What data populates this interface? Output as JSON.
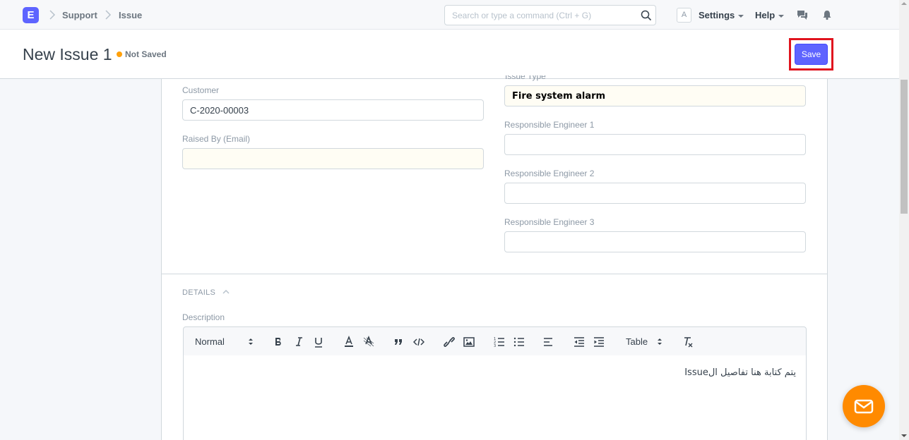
{
  "navbar": {
    "logo_letter": "E",
    "breadcrumbs": [
      "Support",
      "Issue"
    ],
    "search_placeholder": "Search or type a command (Ctrl + G)",
    "avatar_letter": "A",
    "settings_label": "Settings",
    "help_label": "Help"
  },
  "page": {
    "title": "New Issue 1",
    "status": "Not Saved",
    "status_color": "#ffa00a",
    "save_label": "Save",
    "accent": "#5e64ff"
  },
  "form": {
    "customer_label": "Customer",
    "customer_value": "C-2020-00003",
    "raised_by_label": "Raised By (Email)",
    "raised_by_value": "",
    "issue_type_label": "Issue Type",
    "issue_type_value": "Fire system alarm",
    "engineer1_label": "Responsible Engineer 1",
    "engineer1_value": "",
    "engineer2_label": "Responsible Engineer 2",
    "engineer2_value": "",
    "engineer3_label": "Responsible Engineer 3",
    "engineer3_value": ""
  },
  "details": {
    "section_label": "DETAILS",
    "description_label": "Description",
    "toolbar": {
      "format_select": "Normal",
      "table_select": "Table"
    },
    "description_text": "يتم كتابة هنا تفاصيل الIssue"
  },
  "icons": {
    "logo": "erpnext-logo",
    "search": "search-icon",
    "chat": "chat-icon",
    "bell": "bell-icon",
    "fab": "mail-icon"
  }
}
